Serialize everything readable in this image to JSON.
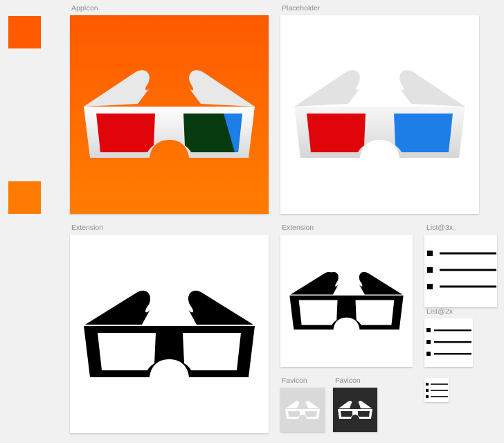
{
  "colors": {
    "swatch_top": "#ff5a00",
    "swatch_bottom": "#ff7b00",
    "appicon_bg_top": "#ff5a00",
    "appicon_bg_bottom": "#ff7d00",
    "lens_red": "#e0050b",
    "lens_green": "#073a0e",
    "lens_blue": "#1d7ee8",
    "frame_light": "#f2f2f2",
    "glyph": "#000000",
    "favicon_light_bg": "#d9d9d9",
    "favicon_dark_bg": "#2b2b2b"
  },
  "artboards": {
    "appicon": {
      "label": "AppIcon",
      "icon": "3d-glasses-color-icon"
    },
    "placeholder": {
      "label": "Placeholder",
      "icon": "3d-glasses-color-icon"
    },
    "extension_large": {
      "label": "Extension",
      "icon": "3d-glasses-glyph-icon"
    },
    "extension_small": {
      "label": "Extension",
      "icon": "3d-glasses-glyph-icon"
    },
    "list3x": {
      "label": "List@3x",
      "icon": "list-icon"
    },
    "list2x": {
      "label": "List@2x",
      "icon": "list-icon"
    },
    "list1x": {
      "icon": "list-icon"
    },
    "favicon_light": {
      "label": "Favicon",
      "icon": "3d-glasses-outline-icon"
    },
    "favicon_dark": {
      "label": "Favicon",
      "icon": "3d-glasses-outline-icon"
    }
  }
}
